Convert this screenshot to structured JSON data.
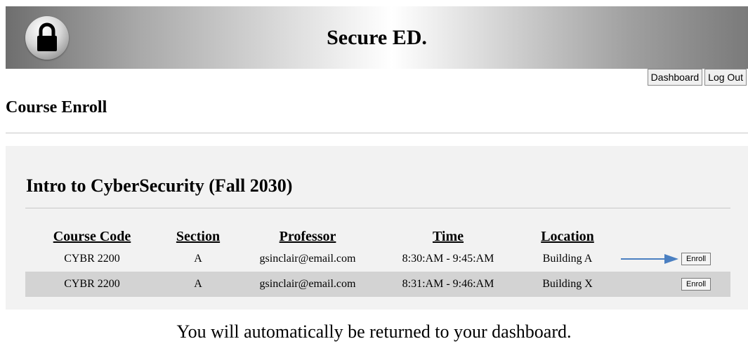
{
  "header": {
    "site_title": "Secure ED.",
    "logo_icon": "lock-icon"
  },
  "nav": {
    "dashboard_label": "Dashboard",
    "logout_label": "Log Out"
  },
  "page": {
    "title": "Course Enroll"
  },
  "course": {
    "name": "Intro to CyberSecurity (Fall 2030)",
    "columns": [
      "Course Code",
      "Section",
      "Professor",
      "Time",
      "Location"
    ],
    "rows": [
      {
        "code": "CYBR 2200",
        "section": "A",
        "professor": "gsinclair@email.com",
        "time": "8:30:AM - 9:45:AM",
        "location": "Building A",
        "action": "Enroll",
        "highlight_icon": "arrow-right-icon"
      },
      {
        "code": "CYBR 2200",
        "section": "A",
        "professor": "gsinclair@email.com",
        "time": "8:31:AM - 9:46:AM",
        "location": "Building X",
        "action": "Enroll"
      }
    ]
  },
  "footer": {
    "message": "You will automatically be returned to your dashboard."
  },
  "colors": {
    "arrow": "#4a7fc1",
    "alt_row": "#d3d3d3",
    "panel": "#f2f2f2"
  }
}
